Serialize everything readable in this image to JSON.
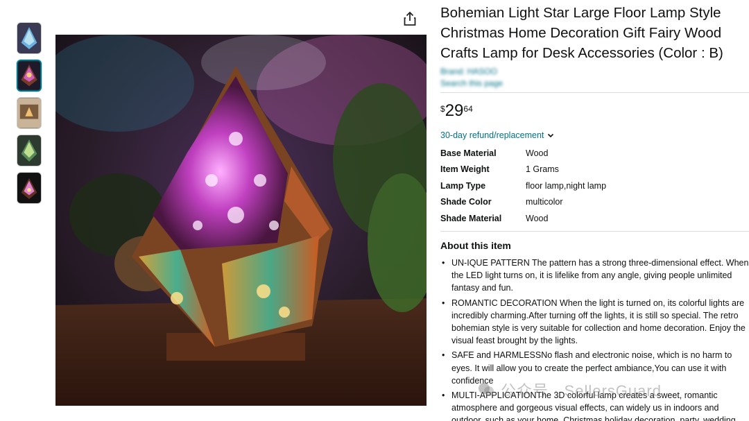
{
  "product": {
    "title": "Bohemian Light Star Large Floor Lamp Style Christmas Home Decoration Gift Fairy Wood Crafts Lamp for Desk Accessories (Color : B)",
    "brand_line": "Brand: HASOO",
    "store_line": "Search this page",
    "price": {
      "symbol": "$",
      "whole": "29",
      "fraction": "64"
    },
    "refund_text": "30-day refund/replacement"
  },
  "specs": [
    {
      "key": "Base Material",
      "value": "Wood"
    },
    {
      "key": "Item Weight",
      "value": "1 Grams"
    },
    {
      "key": "Lamp Type",
      "value": "floor lamp,night lamp"
    },
    {
      "key": "Shade Color",
      "value": "multicolor"
    },
    {
      "key": "Shade Material",
      "value": "Wood"
    }
  ],
  "about": {
    "heading": "About this item",
    "bullets": [
      "UN-IQUE PATTERN The pattern has a strong three-dimensional effect. When the LED light turns on, it is lifelike from any angle, giving people unlimited fantasy and fun.",
      "ROMANTIC DECORATION When the light is turned on, its colorful lights are incredibly charming.After turning off the lights, it is still so special. The retro bohemian style is very suitable for collection and home decoration. Enjoy the visual feast brought by the lights.",
      "SAFE and HARMLESSNo flash and electronic noise, which is no harm to eyes. It will allow you to create the perfect ambiance,You can use it with confidence",
      "MULTI-APPLICATIONThe 3D colorful lamp creates a sweet, romantic atmosphere and gorgeous visual effects, can widely us in indoors and outdoor, such as your home, Christmas holiday decoration, party, wedding, bar, ornament store, patio and courtyard."
    ]
  },
  "watermark": "公众号 · SellersGuard",
  "icons": {
    "share": "share-icon",
    "refund_chevron": "chevron-down-icon"
  },
  "colors": {
    "link": "#007185",
    "text": "#0f1111",
    "divider": "#dddddd"
  }
}
